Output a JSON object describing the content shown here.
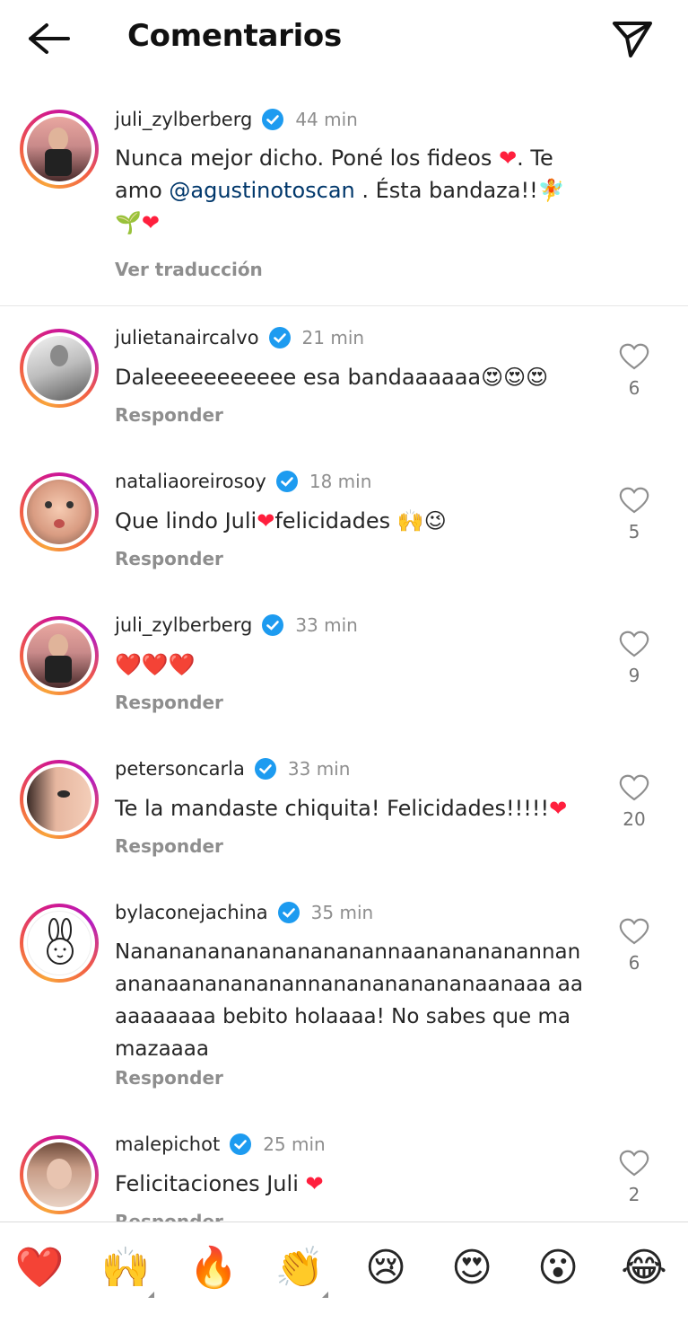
{
  "header": {
    "title": "Comentarios"
  },
  "caption": {
    "username": "juli_zylberberg",
    "time": "44 min",
    "text_1": "Nunca mejor dicho. Poné los fideos ",
    "text_2": ". Te amo ",
    "mention": "@agustinotoscan",
    "text_3": " . Ésta bandaza!!",
    "translate": "Ver traducción"
  },
  "comments": [
    {
      "username": "julietanaircalvo",
      "time": "21 min",
      "text": "Daleeeeeeeeeee esa bandaaaaaa",
      "emoji": "😍😍😍",
      "reply": "Responder",
      "likes": "6"
    },
    {
      "username": "nataliaoreirosoy",
      "time": "18 min",
      "text_a": "Que lindo Juli",
      "text_b": "felicidades ",
      "emoji": "🙌😉",
      "reply": "Responder",
      "likes": "5"
    },
    {
      "username": "juli_zylberberg",
      "time": "33 min",
      "emoji": "❤️❤️❤️",
      "reply": "Responder",
      "likes": "9"
    },
    {
      "username": "petersoncarla",
      "time": "33 min",
      "text": "Te la mandaste chiquita! Felicidades!!!!!",
      "reply": "Responder",
      "likes": "20"
    },
    {
      "username": "bylaconejachina",
      "time": "35 min",
      "text": "Nanananananananananannaananananannan ananaananananannananananananaanaaa aaaaaaaaaa bebito holaaaa! No sabes que mamazaaaa",
      "reply": "Responder",
      "likes": "6"
    },
    {
      "username": "malepichot",
      "time": "25 min",
      "text": "Felicitaciones Juli ",
      "reply": "Responder",
      "likes": "2"
    }
  ],
  "reactions": [
    "❤️",
    "🙌",
    "🔥",
    "👏",
    "😢",
    "😍",
    "😮",
    "😂"
  ],
  "colors": {
    "verified": "#1d9bf0",
    "heart": "#ff1f3d",
    "mention": "#00376b"
  }
}
